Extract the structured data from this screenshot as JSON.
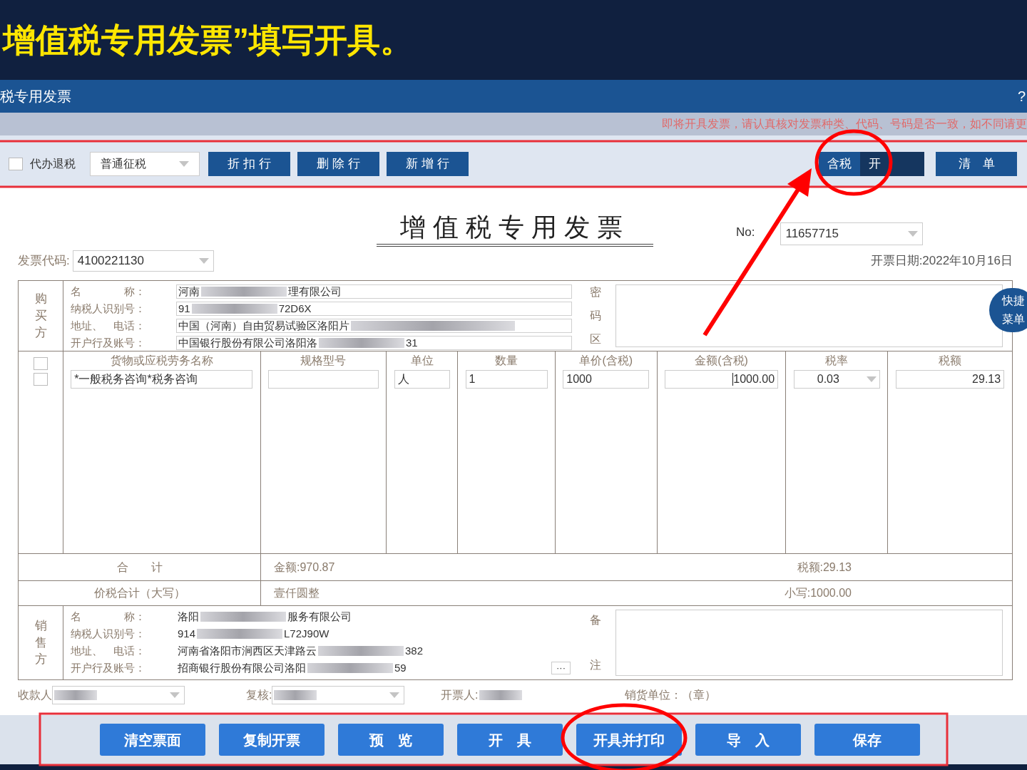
{
  "slide_title": "增值税专用发票”填写开具。",
  "window": {
    "title": "税专用发票",
    "help": "?"
  },
  "notice": "即将开具发票，请认真核对发票种类、代码、号码是否一致，如不同请更",
  "toolbar": {
    "agent_refund": {
      "label": "代办退税",
      "checked": false
    },
    "levy_type": "普通征税",
    "buttons": [
      "折 扣 行",
      "删 除 行",
      "新 增 行"
    ],
    "tax_toggle": {
      "label": "含税",
      "state": "开",
      "on": true
    },
    "list_button": "清　单"
  },
  "invoice": {
    "title": "增值税专用发票",
    "no_label": "No:",
    "no": "11657715",
    "code_label": "发票代码:",
    "code": "4100221130",
    "date": "开票日期:2022年10月16日",
    "buyer": {
      "side_label": "购买方",
      "fields": [
        {
          "label": "名　　　　称：",
          "parts": [
            "河南",
            "理有限公司"
          ]
        },
        {
          "label": "纳税人识别号：",
          "parts": [
            "91",
            "72D6X"
          ]
        },
        {
          "label": "地址、　电话：",
          "parts": [
            "中国（河南）自由贸易试验区洛阳片"
          ]
        },
        {
          "label": "开户行及账号：",
          "parts": [
            "中国银行股份有限公司洛阳洛",
            "31"
          ]
        }
      ]
    },
    "cipher_label": [
      "密",
      "码",
      "区"
    ],
    "quick_menu": "快捷菜单",
    "columns": [
      "货物或应税劳务名称",
      "规格型号",
      "单位",
      "数量",
      "单价(含税)",
      "金额(含税)",
      "税率",
      "税额"
    ],
    "select_all_checked": false,
    "items": [
      {
        "checked": false,
        "name": "*一般税务咨询*税务咨询",
        "unit": "人",
        "quantity": "1",
        "unit_price": "1000",
        "amount": "1000.00",
        "tax_rate": "0.03",
        "tax": "29.13"
      }
    ],
    "total": {
      "label": "合　　计",
      "amount": "金额:970.87",
      "tax": "税额:29.13"
    },
    "grand_total": {
      "label": "价税合计（大写）",
      "words": "壹仟圆整",
      "figures": "小写:1000.00"
    },
    "seller": {
      "side_label": "销售方",
      "fields": [
        {
          "label": "名　　　　称：",
          "parts": [
            "洛阳",
            "服务有限公司"
          ]
        },
        {
          "label": "纳税人识别号：",
          "parts": [
            "914",
            "L72J90W"
          ]
        },
        {
          "label": "地址、　电话：",
          "parts": [
            "河南省洛阳市涧西区天津路云",
            "382"
          ]
        },
        {
          "label": "开户行及账号：",
          "parts": [
            "招商银行股份有限公司洛阳",
            "59"
          ],
          "more": "···"
        }
      ]
    },
    "remarks_label": [
      "备",
      "注"
    ],
    "signatures": [
      {
        "label": "收款人",
        "kind": "select"
      },
      {
        "label": "复核:",
        "kind": "select"
      },
      {
        "label": "开票人:",
        "kind": "text"
      },
      {
        "label": "销货单位：（章）",
        "kind": "plain"
      }
    ]
  },
  "actions": [
    "清空票面",
    "复制开票",
    "预　览",
    "开　具",
    "开具并打印",
    "导　入",
    "保存"
  ]
}
